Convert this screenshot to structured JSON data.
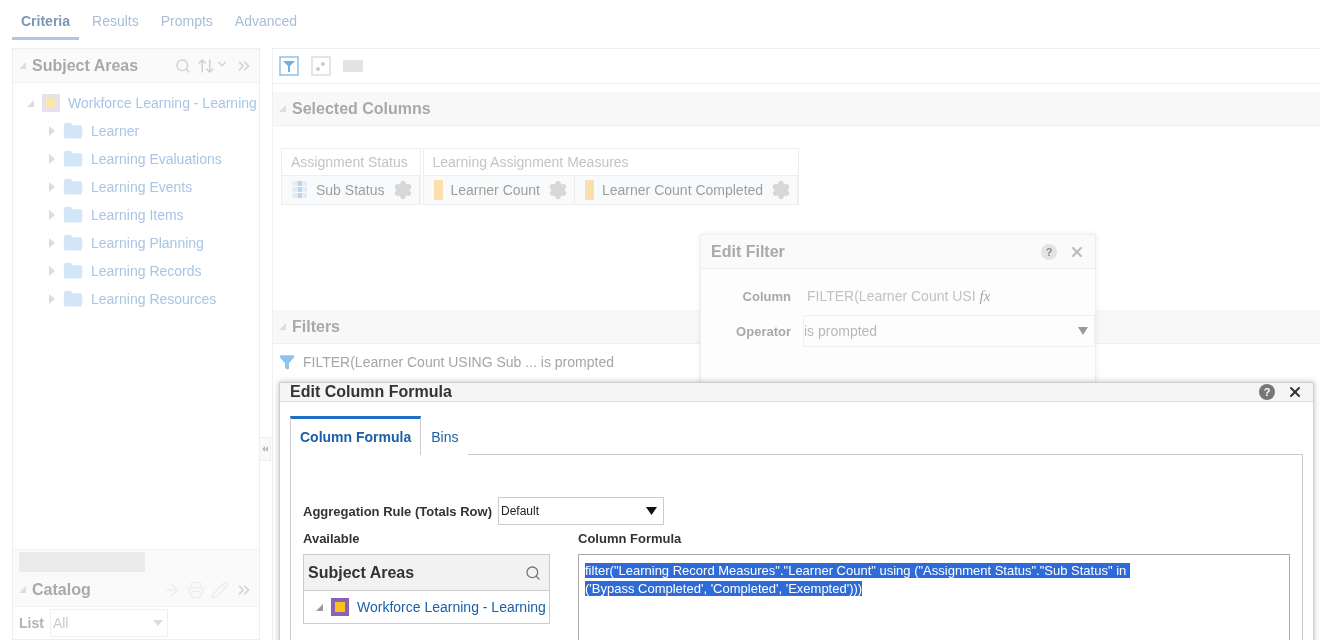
{
  "tabs": [
    {
      "label": "Criteria",
      "selected": true
    },
    {
      "label": "Results",
      "selected": false
    },
    {
      "label": "Prompts",
      "selected": false
    },
    {
      "label": "Advanced",
      "selected": false
    }
  ],
  "subject_areas": {
    "title": "Subject Areas",
    "root": {
      "label": "Workforce Learning - Learning",
      "expanded": true,
      "children": [
        {
          "label": "Learner",
          "expanded": false
        },
        {
          "label": "Learning Evaluations",
          "expanded": false
        },
        {
          "label": "Learning Events",
          "expanded": false
        },
        {
          "label": "Learning Items",
          "expanded": false
        },
        {
          "label": "Learning Planning",
          "expanded": false
        },
        {
          "label": "Learning Records",
          "expanded": false
        },
        {
          "label": "Learning Resources",
          "expanded": false
        }
      ]
    }
  },
  "catalog": {
    "title": "Catalog",
    "list_label": "List",
    "list_value": "All"
  },
  "selected_columns": {
    "title": "Selected Columns",
    "groups": [
      {
        "label": "Assignment Status",
        "columns": [
          {
            "label": "Sub Status",
            "kind": "attribute"
          }
        ]
      },
      {
        "label": "Learning Assignment Measures",
        "columns": [
          {
            "label": "Learner Count",
            "kind": "measure"
          },
          {
            "label": "Learner Count Completed",
            "kind": "measure"
          }
        ]
      }
    ]
  },
  "filters": {
    "title": "Filters",
    "items": [
      {
        "text": "FILTER(Learner Count USING Sub ... is prompted"
      }
    ]
  },
  "edit_filter": {
    "title": "Edit Filter",
    "help": "?",
    "formula_button": "fx",
    "column_label": "Column",
    "column_value": "FILTER(Learner Count USI",
    "operator_label": "Operator",
    "operator_value": "is prompted"
  },
  "edit_column_formula": {
    "title": "Edit Column Formula",
    "help": "?",
    "tabs": [
      {
        "label": "Column Formula",
        "selected": true
      },
      {
        "label": "Bins",
        "selected": false
      }
    ],
    "aggregation_label": "Aggregation Rule (Totals Row)",
    "aggregation_value": "Default",
    "available_label": "Available",
    "subject_areas_title": "Subject Areas",
    "tree_root": {
      "label": "Workforce Learning - Learning",
      "expanded": true
    },
    "formula_label": "Column Formula",
    "formula": "filter(\"Learning Record Measures\".\"Learner Count\" using (\"Assignment Status\".\"Sub Status\" in \n('Bypass Completed', 'Completed', 'Exempted')))"
  }
}
